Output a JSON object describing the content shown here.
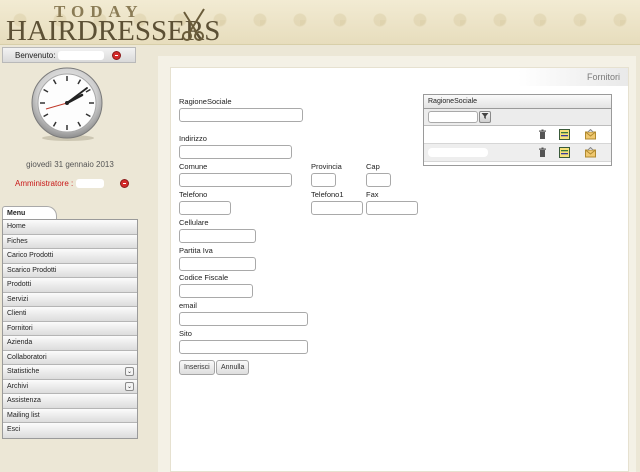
{
  "header": {
    "logo_top": "TODAY",
    "logo_main": "HAIRDRESSERS"
  },
  "welcome": {
    "label": "Benvenuto:"
  },
  "date_line": "giovedì 31 gennaio 2013",
  "admin_label": "Amministratore :",
  "menu": {
    "tab_label": "Menu",
    "items": [
      {
        "label": "Home"
      },
      {
        "label": "Fiches"
      },
      {
        "label": "Carico Prodotti"
      },
      {
        "label": "Scarico Prodotti"
      },
      {
        "label": "Prodotti"
      },
      {
        "label": "Servizi"
      },
      {
        "label": "Clienti"
      },
      {
        "label": "Fornitori"
      },
      {
        "label": "Azienda"
      },
      {
        "label": "Collaboratori"
      },
      {
        "label": "Statistiche",
        "expand": "⌄"
      },
      {
        "label": "Archivi",
        "expand": "⌄"
      },
      {
        "label": "Assistenza"
      },
      {
        "label": "Mailing list"
      },
      {
        "label": "Esci"
      }
    ]
  },
  "panel": {
    "title": "Fornitori"
  },
  "form": {
    "ragione_sociale": "RagioneSociale",
    "indirizzo": "Indirizzo",
    "comune": "Comune",
    "provincia": "Provincia",
    "cap": "Cap",
    "telefono": "Telefono",
    "telefono1": "Telefono1",
    "fax": "Fax",
    "cellulare": "Cellulare",
    "partita_iva": "Partita Iva",
    "codice_fiscale": "Codice Fiscale",
    "email": "email",
    "sito": "Sito",
    "btn_insert": "Inserisci",
    "btn_cancel": "Annulla"
  },
  "grid": {
    "header": "RagioneSociale",
    "filter_icon": "funnel-icon",
    "row_icons": [
      "trash-icon",
      "edit-icon",
      "mail-icon"
    ]
  },
  "colors": {
    "background": "#ece7d6",
    "admin_red": "#c81818",
    "logo_brown": "#5c5035"
  }
}
